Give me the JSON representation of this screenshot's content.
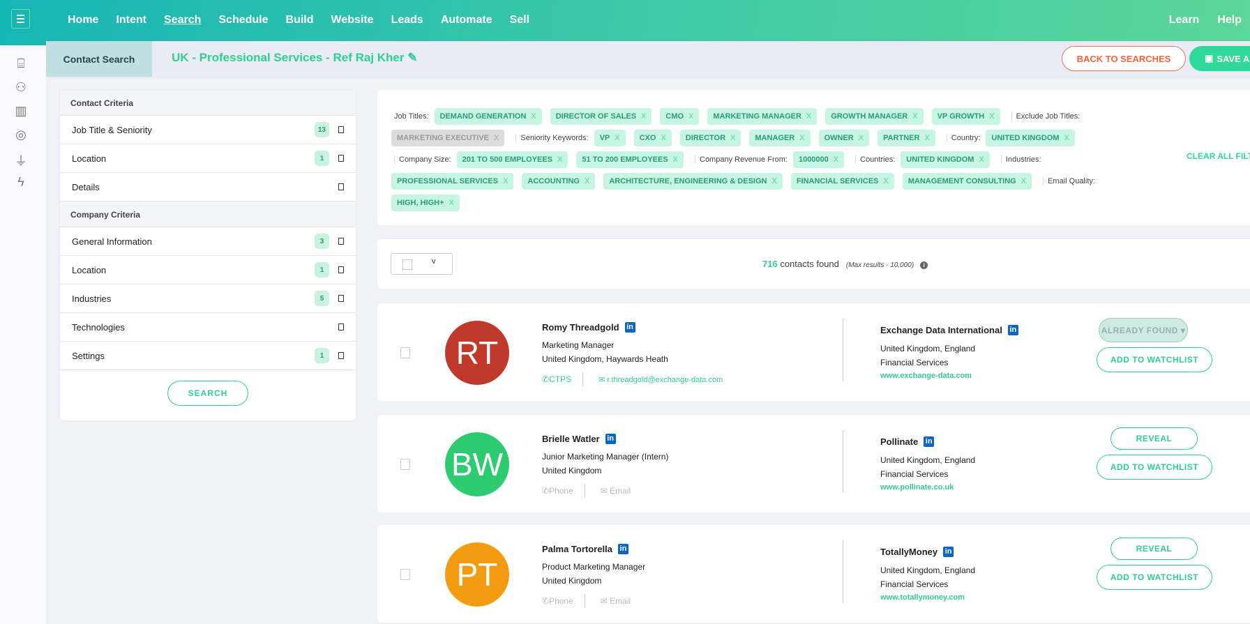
{
  "topnav": {
    "items": [
      "Home",
      "Intent",
      "Search",
      "Schedule",
      "Build",
      "Website",
      "Leads",
      "Automate",
      "Sell"
    ],
    "active": "Search",
    "right_items": [
      "Learn",
      "Help"
    ]
  },
  "rail_icons": [
    "toolbox-icon",
    "people-icon",
    "chart-icon",
    "target-icon",
    "plug-icon",
    "lightning-icon"
  ],
  "subheader": {
    "tab": "Contact Search",
    "title": "UK - Professional Services - Ref Raj Kher",
    "back_label": "BACK TO SEARCHES",
    "save_label": "SAVE AND"
  },
  "criteria": {
    "contact_header": "Contact Criteria",
    "contact_rows": [
      {
        "label": "Job Title & Seniority",
        "count": "13"
      },
      {
        "label": "Location",
        "count": "1"
      },
      {
        "label": "Details",
        "count": null
      }
    ],
    "company_header": "Company Criteria",
    "company_rows": [
      {
        "label": "General Information",
        "count": "3"
      },
      {
        "label": "Location",
        "count": "1"
      },
      {
        "label": "Industries",
        "count": "5"
      },
      {
        "label": "Technologies",
        "count": null
      },
      {
        "label": "Settings",
        "count": "1"
      }
    ],
    "search_label": "SEARCH"
  },
  "filters": {
    "clear_all": "CLEAR ALL FILTERS",
    "x": "X",
    "labels": {
      "job_titles": "Job Titles:",
      "exclude": "Exclude Job Titles:",
      "seniority": "Seniority Keywords:",
      "country": "Country:",
      "company_size": "Company Size:",
      "revenue": "Company Revenue From:",
      "countries": "Countries:",
      "industries": "Industries:",
      "email_quality": "Email Quality:"
    },
    "job_titles": [
      "DEMAND GENERATION",
      "DIRECTOR OF SALES",
      "CMO",
      "MARKETING MANAGER",
      "GROWTH MANAGER",
      "VP GROWTH"
    ],
    "exclude": [
      "MARKETING EXECUTIVE"
    ],
    "seniority": [
      "VP",
      "CXO",
      "DIRECTOR",
      "MANAGER",
      "OWNER",
      "PARTNER"
    ],
    "country": [
      "UNITED KINGDOM"
    ],
    "company_size": [
      "201 TO 500 EMPLOYEES",
      "51 TO 200 EMPLOYEES"
    ],
    "revenue": [
      "1000000"
    ],
    "countries": [
      "UNITED KINGDOM"
    ],
    "industries": [
      "PROFESSIONAL SERVICES",
      "ACCOUNTING",
      "ARCHITECTURE, ENGINEERING & DESIGN",
      "FINANCIAL SERVICES",
      "MANAGEMENT CONSULTING"
    ],
    "email_quality": [
      "HIGH, HIGH+"
    ]
  },
  "results": {
    "count": "716",
    "found_label": "contacts found",
    "max_label": "(Max results - 10,000)",
    "info": "i",
    "select_caret": "v"
  },
  "contacts": [
    {
      "initials": "RT",
      "color": "#c0392b",
      "name": "Romy Threadgold",
      "title": "Marketing Manager",
      "location": "United Kingdom, Haywards Heath",
      "phone": "CTPS",
      "email": "r.threadgold@exchange-data.com",
      "revealed": true,
      "company": "Exchange Data International",
      "company_location": "United Kingdom, England",
      "industry": "Financial Services",
      "website": "www.exchange-data.com",
      "primary_action": "ALREADY FOUND ▾",
      "watch": "ADD TO WATCHLIST"
    },
    {
      "initials": "BW",
      "color": "#2ecc71",
      "name": "Brielle Watler",
      "title": "Junior Marketing Manager (Intern)",
      "location": "United Kingdom",
      "phone": "Phone",
      "email": "Email",
      "revealed": false,
      "company": "Pollinate",
      "company_location": "United Kingdom, England",
      "industry": "Financial Services",
      "website": "www.pollinate.co.uk",
      "primary_action": "REVEAL",
      "watch": "ADD TO WATCHLIST"
    },
    {
      "initials": "PT",
      "color": "#f39c12",
      "name": "Palma Tortorella",
      "title": "Product Marketing Manager",
      "location": "United Kingdom",
      "phone": "Phone",
      "email": "Email",
      "revealed": false,
      "company": "TotallyMoney",
      "company_location": "United Kingdom, England",
      "industry": "Financial Services",
      "website": "www.totallymoney.com",
      "primary_action": "REVEAL",
      "watch": "ADD TO WATCHLIST"
    }
  ],
  "linkedin": "in"
}
